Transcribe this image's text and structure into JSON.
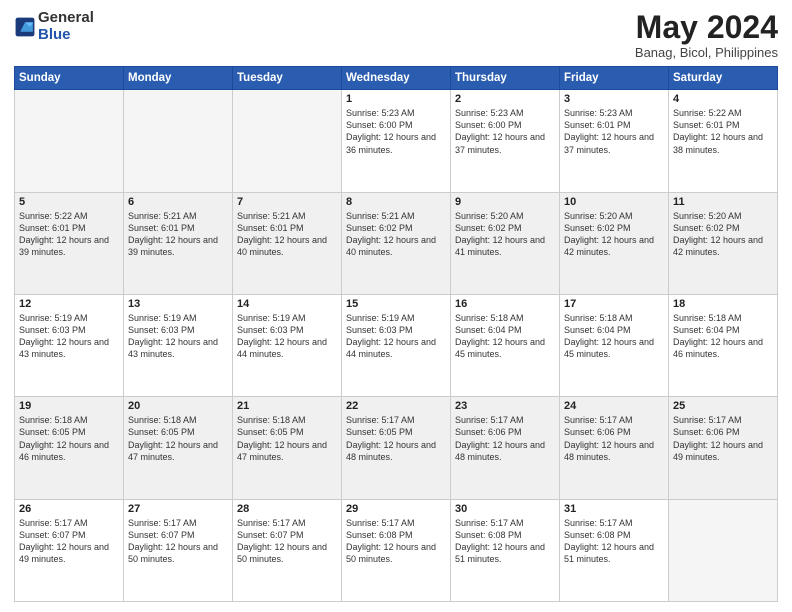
{
  "header": {
    "logo_general": "General",
    "logo_blue": "Blue",
    "month_title": "May 2024",
    "location": "Banag, Bicol, Philippines"
  },
  "days_of_week": [
    "Sunday",
    "Monday",
    "Tuesday",
    "Wednesday",
    "Thursday",
    "Friday",
    "Saturday"
  ],
  "weeks": [
    [
      {
        "day": "",
        "empty": true
      },
      {
        "day": "",
        "empty": true
      },
      {
        "day": "",
        "empty": true
      },
      {
        "day": "1",
        "sunrise": "5:23 AM",
        "sunset": "6:00 PM",
        "daylight": "12 hours and 36 minutes."
      },
      {
        "day": "2",
        "sunrise": "5:23 AM",
        "sunset": "6:00 PM",
        "daylight": "12 hours and 37 minutes."
      },
      {
        "day": "3",
        "sunrise": "5:23 AM",
        "sunset": "6:01 PM",
        "daylight": "12 hours and 37 minutes."
      },
      {
        "day": "4",
        "sunrise": "5:22 AM",
        "sunset": "6:01 PM",
        "daylight": "12 hours and 38 minutes."
      }
    ],
    [
      {
        "day": "5",
        "sunrise": "5:22 AM",
        "sunset": "6:01 PM",
        "daylight": "12 hours and 39 minutes."
      },
      {
        "day": "6",
        "sunrise": "5:21 AM",
        "sunset": "6:01 PM",
        "daylight": "12 hours and 39 minutes."
      },
      {
        "day": "7",
        "sunrise": "5:21 AM",
        "sunset": "6:01 PM",
        "daylight": "12 hours and 40 minutes."
      },
      {
        "day": "8",
        "sunrise": "5:21 AM",
        "sunset": "6:02 PM",
        "daylight": "12 hours and 40 minutes."
      },
      {
        "day": "9",
        "sunrise": "5:20 AM",
        "sunset": "6:02 PM",
        "daylight": "12 hours and 41 minutes."
      },
      {
        "day": "10",
        "sunrise": "5:20 AM",
        "sunset": "6:02 PM",
        "daylight": "12 hours and 42 minutes."
      },
      {
        "day": "11",
        "sunrise": "5:20 AM",
        "sunset": "6:02 PM",
        "daylight": "12 hours and 42 minutes."
      }
    ],
    [
      {
        "day": "12",
        "sunrise": "5:19 AM",
        "sunset": "6:03 PM",
        "daylight": "12 hours and 43 minutes."
      },
      {
        "day": "13",
        "sunrise": "5:19 AM",
        "sunset": "6:03 PM",
        "daylight": "12 hours and 43 minutes."
      },
      {
        "day": "14",
        "sunrise": "5:19 AM",
        "sunset": "6:03 PM",
        "daylight": "12 hours and 44 minutes."
      },
      {
        "day": "15",
        "sunrise": "5:19 AM",
        "sunset": "6:03 PM",
        "daylight": "12 hours and 44 minutes."
      },
      {
        "day": "16",
        "sunrise": "5:18 AM",
        "sunset": "6:04 PM",
        "daylight": "12 hours and 45 minutes."
      },
      {
        "day": "17",
        "sunrise": "5:18 AM",
        "sunset": "6:04 PM",
        "daylight": "12 hours and 45 minutes."
      },
      {
        "day": "18",
        "sunrise": "5:18 AM",
        "sunset": "6:04 PM",
        "daylight": "12 hours and 46 minutes."
      }
    ],
    [
      {
        "day": "19",
        "sunrise": "5:18 AM",
        "sunset": "6:05 PM",
        "daylight": "12 hours and 46 minutes."
      },
      {
        "day": "20",
        "sunrise": "5:18 AM",
        "sunset": "6:05 PM",
        "daylight": "12 hours and 47 minutes."
      },
      {
        "day": "21",
        "sunrise": "5:18 AM",
        "sunset": "6:05 PM",
        "daylight": "12 hours and 47 minutes."
      },
      {
        "day": "22",
        "sunrise": "5:17 AM",
        "sunset": "6:05 PM",
        "daylight": "12 hours and 48 minutes."
      },
      {
        "day": "23",
        "sunrise": "5:17 AM",
        "sunset": "6:06 PM",
        "daylight": "12 hours and 48 minutes."
      },
      {
        "day": "24",
        "sunrise": "5:17 AM",
        "sunset": "6:06 PM",
        "daylight": "12 hours and 48 minutes."
      },
      {
        "day": "25",
        "sunrise": "5:17 AM",
        "sunset": "6:06 PM",
        "daylight": "12 hours and 49 minutes."
      }
    ],
    [
      {
        "day": "26",
        "sunrise": "5:17 AM",
        "sunset": "6:07 PM",
        "daylight": "12 hours and 49 minutes."
      },
      {
        "day": "27",
        "sunrise": "5:17 AM",
        "sunset": "6:07 PM",
        "daylight": "12 hours and 50 minutes."
      },
      {
        "day": "28",
        "sunrise": "5:17 AM",
        "sunset": "6:07 PM",
        "daylight": "12 hours and 50 minutes."
      },
      {
        "day": "29",
        "sunrise": "5:17 AM",
        "sunset": "6:08 PM",
        "daylight": "12 hours and 50 minutes."
      },
      {
        "day": "30",
        "sunrise": "5:17 AM",
        "sunset": "6:08 PM",
        "daylight": "12 hours and 51 minutes."
      },
      {
        "day": "31",
        "sunrise": "5:17 AM",
        "sunset": "6:08 PM",
        "daylight": "12 hours and 51 minutes."
      },
      {
        "day": "",
        "empty": true
      }
    ]
  ],
  "labels": {
    "sunrise_prefix": "Sunrise: ",
    "sunset_prefix": "Sunset: ",
    "daylight_prefix": "Daylight: "
  }
}
